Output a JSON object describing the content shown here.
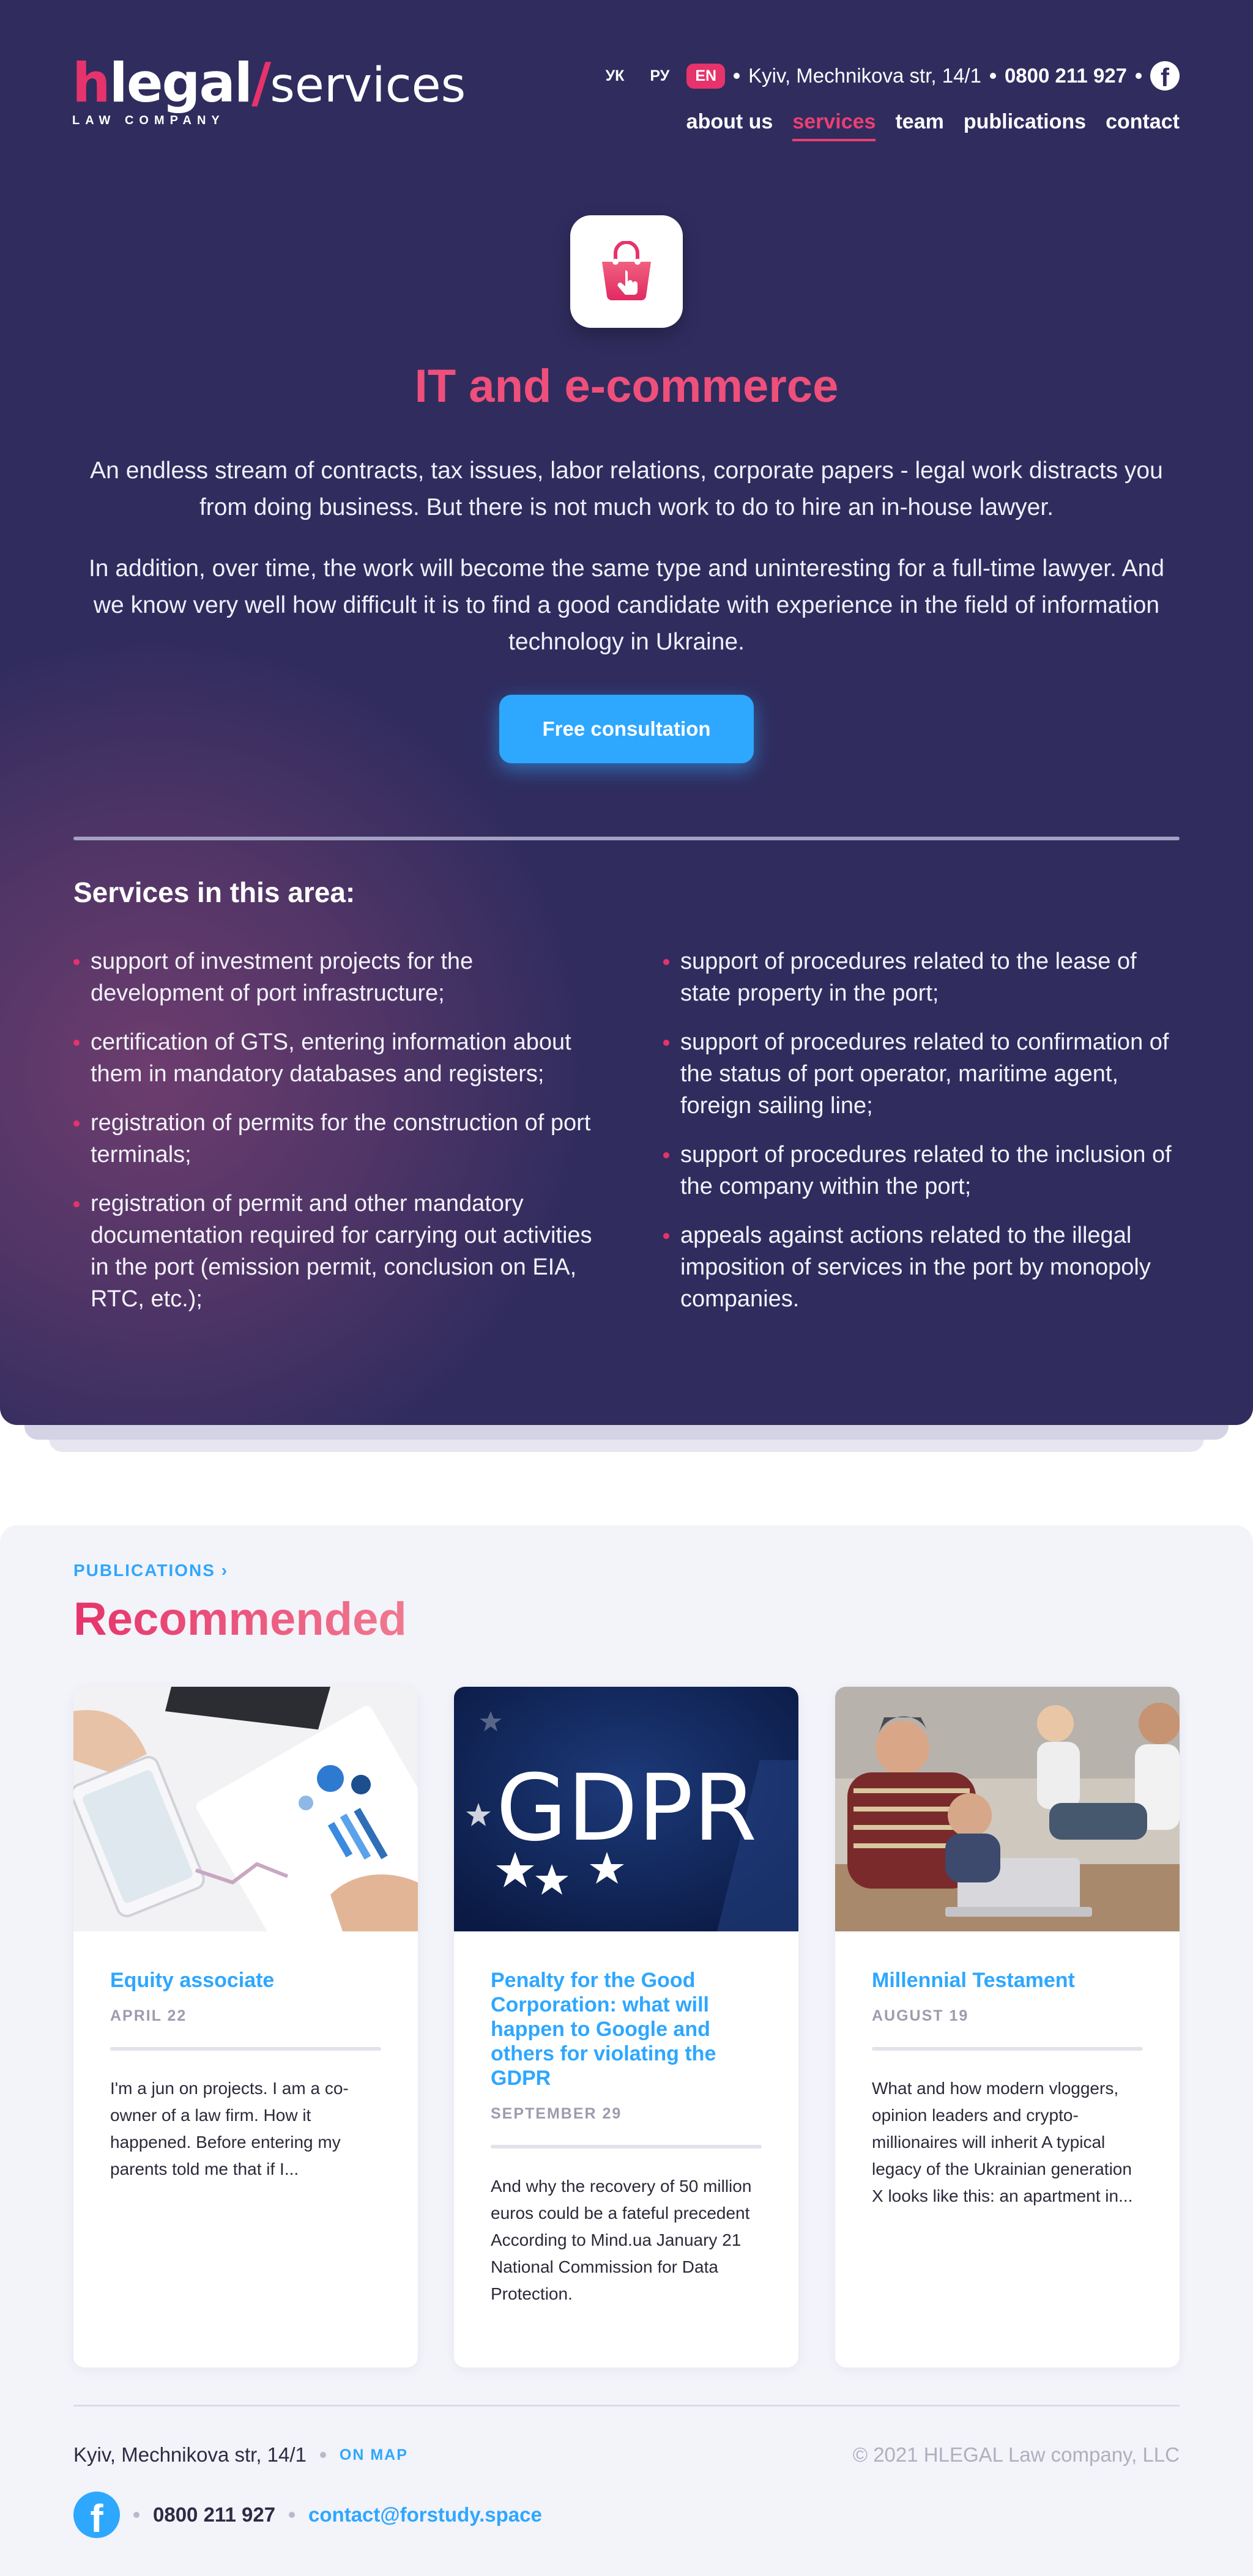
{
  "header": {
    "logo": {
      "h": "h",
      "legal": "legal",
      "slash": "/",
      "services": "services",
      "subtitle": "LAW COMPANY"
    },
    "languages": [
      {
        "label": "УК"
      },
      {
        "label": "РУ"
      },
      {
        "label": "EN",
        "active": true
      }
    ],
    "address": "Kyiv, Mechnikova str, 14/1",
    "phone": "0800 211 927",
    "facebook_icon": "facebook-icon",
    "nav": [
      {
        "label": "about us"
      },
      {
        "label": "services",
        "active": true
      },
      {
        "label": "team"
      },
      {
        "label": "publications"
      },
      {
        "label": "contact"
      }
    ]
  },
  "hero": {
    "icon": "shopping-bag-icon",
    "title": "IT and e-commerce",
    "paragraph1": "An endless stream of contracts, tax issues, labor relations, corporate papers - legal work distracts you from doing business. But there is not much work to do to hire an in-house lawyer.",
    "paragraph2": "In addition, over time, the work will become the same type and uninteresting for a full-time lawyer. And we know very well how difficult it is to find a good candidate with experience in the field of information technology in Ukraine.",
    "cta_label": "Free consultation"
  },
  "services": {
    "title": "Services in this area:",
    "left": [
      "support of investment projects for the development of port infrastructure;",
      "certification of GTS, entering information about them in mandatory databases and registers;",
      "registration of permits for the construction of port terminals;",
      "registration of permit and other mandatory documentation required for carrying out activities in the port (emission permit, conclusion on EIA, RTC, etc.);"
    ],
    "right": [
      "support of procedures related to the lease of state property in the port;",
      "support of procedures related to confirmation of the status of port operator, maritime agent, foreign sailing line;",
      "support of procedures related to the inclusion of the company within the port;",
      "appeals against actions related to the illegal imposition of services in the port by monopoly companies."
    ]
  },
  "publications": {
    "link_label": "PUBLICATIONS",
    "heading": "Recommended",
    "cards": [
      {
        "title": "Equity associate",
        "date": "APRIL 22",
        "excerpt": "I'm a jun on projects. I am a co-owner of a law firm. How it happened. Before entering my parents told me that if I..."
      },
      {
        "title": "Penalty for the Good Corporation: what will happen to Google and others for violating the GDPR",
        "date": "SEPTEMBER 29",
        "excerpt": "And why the recovery of 50 million euros could be a fateful precedent According to Mind.ua January 21 National Commission for Data Protection.",
        "image_text": "GDPR"
      },
      {
        "title": "Millennial Testament",
        "date": "AUGUST 19",
        "excerpt": "What and how modern vloggers, opinion leaders and crypto-millionaires will inherit A typical legacy of the Ukrainian generation X looks like this: an apartment in..."
      }
    ]
  },
  "footer": {
    "address": "Kyiv, Mechnikova str, 14/1",
    "on_map": "ON MAP",
    "copyright": "© 2021 HLEGAL Law company, LLC",
    "phone": "0800 211 927",
    "email": "contact@forstudy.space"
  }
}
